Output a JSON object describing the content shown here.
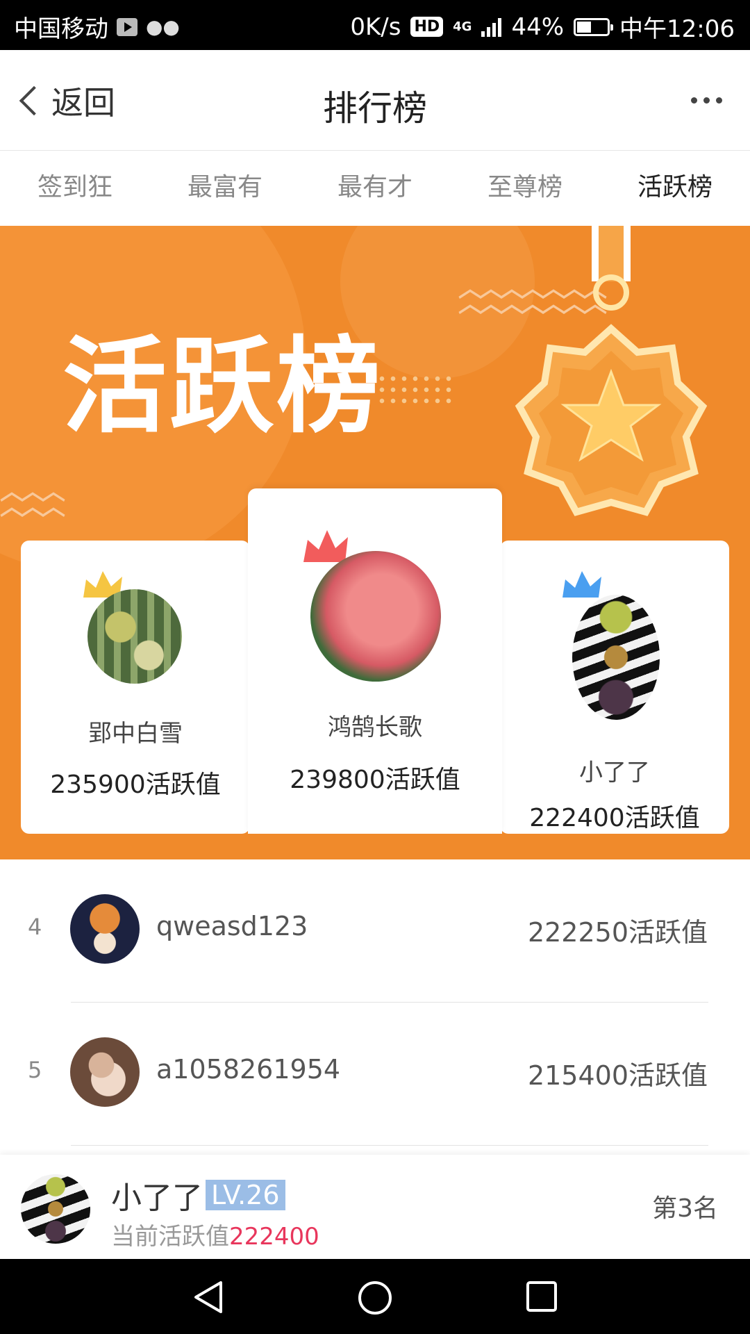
{
  "status_bar": {
    "carrier": "中国移动",
    "net_speed": "0K/s",
    "hd_badge": "HD",
    "network": "4G",
    "battery": "44%",
    "time": "中午12:06"
  },
  "header": {
    "back_label": "返回",
    "title": "排行榜"
  },
  "tabs": [
    {
      "label": "签到狂",
      "active": false
    },
    {
      "label": "最富有",
      "active": false
    },
    {
      "label": "最有才",
      "active": false
    },
    {
      "label": "至尊榜",
      "active": false
    },
    {
      "label": "活跃榜",
      "active": true
    }
  ],
  "banner": {
    "title": "活跃榜",
    "colors": {
      "background": "#f08a2b",
      "medal": "#f7a84a",
      "star": "#ffcc66"
    }
  },
  "podium": {
    "first": {
      "name": "鸿鹄长歌",
      "score": "239800活跃值",
      "crown_color": "#f25c5c"
    },
    "second": {
      "name": "郢中白雪",
      "score": "235900活跃值",
      "crown_color": "#f5c542"
    },
    "third": {
      "name": "小了了",
      "score": "222400活跃值",
      "crown_color": "#4a9ff0"
    }
  },
  "ranking": [
    {
      "rank": "4",
      "name": "qweasd123",
      "score": "222250活跃值"
    },
    {
      "rank": "5",
      "name": "a1058261954",
      "score": "215400活跃值"
    }
  ],
  "me": {
    "name": "小了了",
    "level": "LV.26",
    "score_label": "当前活跃值",
    "score_value": "222400",
    "rank": "第3名"
  }
}
